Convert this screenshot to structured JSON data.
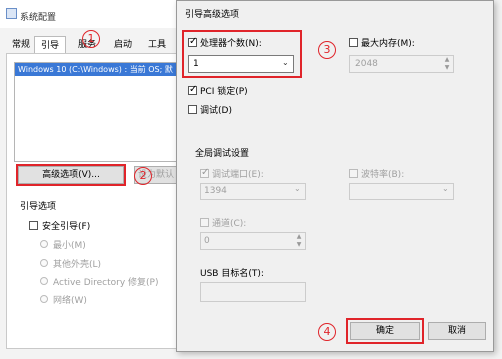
{
  "window": {
    "title": "系统配置"
  },
  "tabs": [
    {
      "label": "常规"
    },
    {
      "label": "引导"
    },
    {
      "label": "服务"
    },
    {
      "label": "启动"
    },
    {
      "label": "工具"
    }
  ],
  "boot_list": {
    "selected": "Windows 10 (C:\\Windows) : 当前 OS; 默"
  },
  "advanced_button": "高级选项(V)...",
  "default_button": "设为默认",
  "boot_options": {
    "group": "引导选项",
    "safe_boot": "安全引导(F)",
    "radios": [
      "最小(M)",
      "其他外壳(L)",
      "Active Directory 修复(P)",
      "网络(W)"
    ]
  },
  "dialog": {
    "title": "引导高级选项",
    "num_processors": {
      "label": "处理器个数(N):",
      "checked": true,
      "value": "1"
    },
    "max_memory": {
      "label": "最大内存(M):",
      "checked": false,
      "value": "2048"
    },
    "pci_lock": {
      "label": "PCI 锁定(P)",
      "checked": true
    },
    "debug": {
      "label": "调试(D)",
      "checked": false
    },
    "global_debug": {
      "title": "全局调试设置",
      "debug_port": {
        "label": "调试端口(E):",
        "value": "1394"
      },
      "baud_rate": {
        "label": "波特率(B):"
      },
      "channel": {
        "label": "通道(C):",
        "value": "0"
      },
      "usb_target": {
        "label": "USB 目标名(T):"
      }
    },
    "ok": "确定",
    "cancel": "取消"
  },
  "annotations": [
    "1",
    "2",
    "3",
    "4"
  ],
  "colors": {
    "accent_red": "#e0242a",
    "selection": "#3a78d6"
  }
}
